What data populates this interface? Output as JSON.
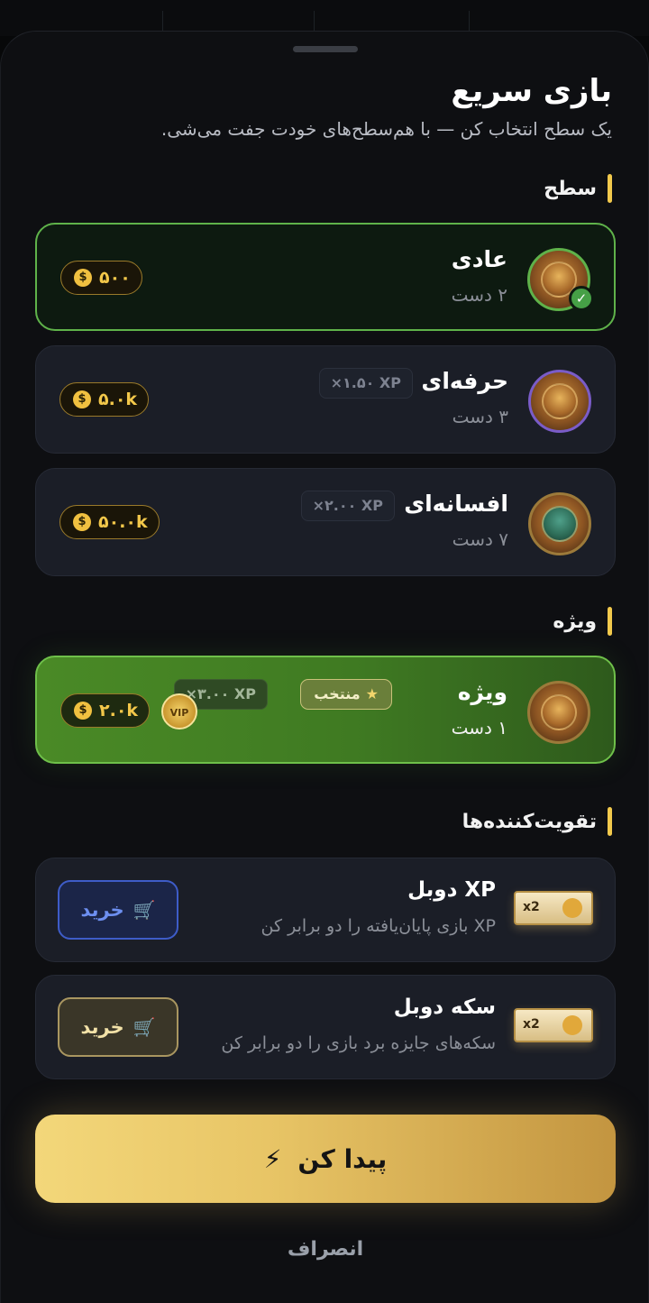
{
  "header": {
    "title": "بازی سریع",
    "subtitle": "یک سطح انتخاب کن — با هم‌سطح‌های خودت جفت می‌شی."
  },
  "sections": {
    "level": "سطح",
    "special": "ویژه",
    "boosters": "تقویت‌کننده‌ها"
  },
  "levels": [
    {
      "name": "عادی",
      "hands": "۲ دست",
      "coins": "۵۰۰",
      "xp": "",
      "selected": true
    },
    {
      "name": "حرفه‌ای",
      "hands": "۳ دست",
      "coins": "۵.۰k",
      "xp": "×۱.۵۰ XP",
      "selected": false
    },
    {
      "name": "افسانه‌ای",
      "hands": "۷ دست",
      "coins": "۵۰.۰k",
      "xp": "×۲.۰۰ XP",
      "selected": false
    }
  ],
  "vip": {
    "name": "ویژه",
    "hands": "۱ دست",
    "pick_label": "منتخب",
    "xp": "×۳.۰۰ XP",
    "coins": "۲.۰k",
    "badge": "VIP"
  },
  "boosters": [
    {
      "name": "XP دوبل",
      "desc": "XP بازی پایان‌یافته را دو برابر کن",
      "buy": "خرید",
      "ticket": "x2"
    },
    {
      "name": "سکه دوبل",
      "desc": "سکه‌های جایزه برد بازی را دو برابر کن",
      "buy": "خرید",
      "ticket": "x2"
    }
  ],
  "actions": {
    "find": "پیدا کن",
    "cancel": "انصراف"
  },
  "icons": {
    "coin": "dollar-coin-icon",
    "check": "check-icon",
    "cart": "cart-plus-icon",
    "bolt": "lightning-icon",
    "star": "star-icon"
  },
  "colors": {
    "accent_gold": "#f2c94c",
    "selected_green": "#5fb24a",
    "buy_blue": "#3e5cc8"
  }
}
